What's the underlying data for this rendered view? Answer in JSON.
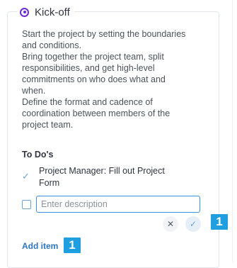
{
  "header": {
    "title": "Kick-off",
    "icon": "target-icon"
  },
  "description": "Start the project by setting the boundaries\nand conditions.\nBring together the project team, split\nresponsibilities, and get high-level\ncommitments on who does what and\nwhen.\nDefine the format and cadence of\ncoordination between members of the\nproject team.",
  "todos": {
    "label": "To Do's",
    "items": [
      {
        "text": "Project Manager: Fill out Project\nForm",
        "done": true
      }
    ],
    "new_item": {
      "placeholder": "Enter description",
      "value": ""
    }
  },
  "actions": {
    "cancel_icon": "close-icon",
    "confirm_icon": "check-icon",
    "cancel_glyph": "✕",
    "confirm_glyph": "✓",
    "add_item": "Add item"
  },
  "badges": [
    "1",
    "1"
  ],
  "colors": {
    "accent": "#6f2bd9",
    "link": "#2f74c0",
    "badge": "#1f9ee0",
    "input_focus": "#3d93e0"
  }
}
